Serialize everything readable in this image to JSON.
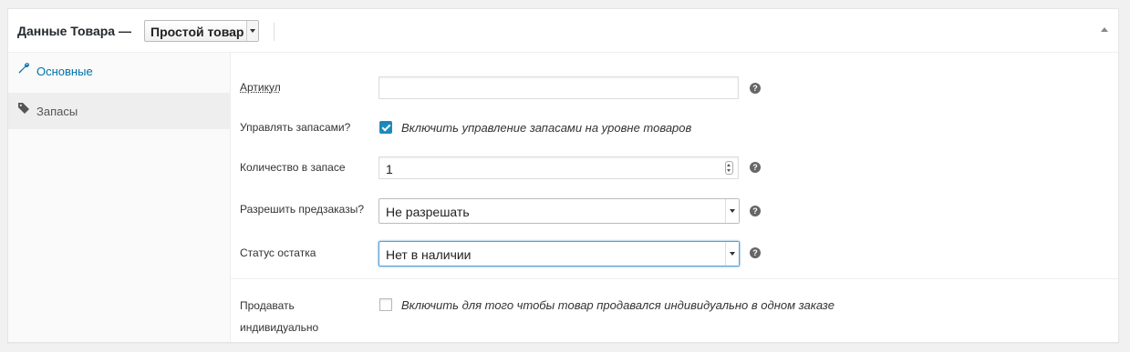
{
  "header": {
    "title": "Данные Товара —",
    "product_type": "Простой товар"
  },
  "tabs": [
    {
      "label": "Основные",
      "icon": "wrench-icon",
      "active": true
    },
    {
      "label": "Запасы",
      "icon": "tag-icon",
      "active": false
    }
  ],
  "fields": {
    "sku": {
      "label": "Артикул",
      "value": "",
      "help": "?"
    },
    "manage_stock": {
      "label": "Управлять запасами?",
      "checked": true,
      "description": "Включить управление запасами на уровне товаров"
    },
    "stock_qty": {
      "label": "Количество в запасе",
      "value": "1",
      "help": "?"
    },
    "backorders": {
      "label": "Разрешить предзаказы?",
      "value": "Не разрешать",
      "help": "?"
    },
    "stock_status": {
      "label": "Статус остатка",
      "value": "Нет в наличии",
      "help": "?"
    },
    "sold_individually": {
      "label_line1": "Продавать",
      "label_line2": "индивидуально",
      "checked": false,
      "description": "Включить для того чтобы товар продавался индивидуально в одном заказе"
    }
  },
  "colors": {
    "accent": "#0073aa",
    "checkbox": "#1e8cbe"
  }
}
